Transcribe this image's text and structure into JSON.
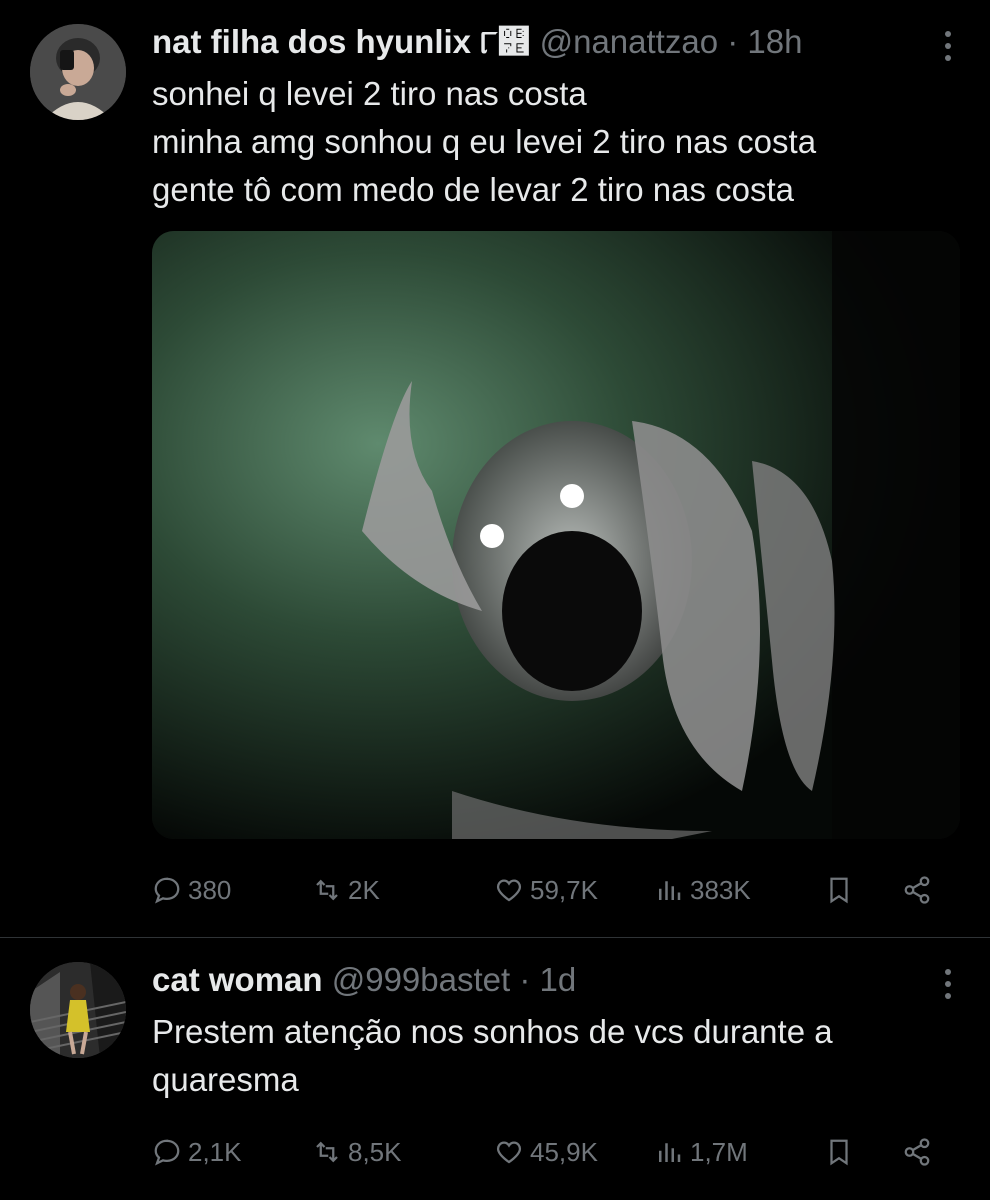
{
  "tweets": [
    {
      "name": "nat filha dos hyunlix ୮୾",
      "handle": "@nanattzao",
      "time": "18h",
      "lines": [
        "sonhei q levei 2 tiro nas costa",
        "minha amg sonhou q eu levei 2 tiro nas costa",
        "gente tô com medo de levar 2 tiro nas costa"
      ],
      "replies": "380",
      "reposts": "2K",
      "likes": "59,7K",
      "views": "383K"
    },
    {
      "name": "cat woman",
      "handle": "@999bastet",
      "time": "1d",
      "lines": [
        "Prestem atenção nos sonhos de vcs durante a",
        "quaresma"
      ],
      "replies": "2,1K",
      "reposts": "8,5K",
      "likes": "45,9K",
      "views": "1,7M"
    }
  ],
  "icons": {
    "reply": "reply-icon",
    "repost": "repost-icon",
    "like": "heart-icon",
    "views": "views-icon",
    "bookmark": "bookmark-icon",
    "share": "share-icon",
    "more": "more-icon"
  },
  "colors": {
    "background": "#000000",
    "text": "#e7e9ea",
    "muted": "#71767b",
    "separator": "#2f3336"
  },
  "separators": {
    "dot": "·"
  }
}
